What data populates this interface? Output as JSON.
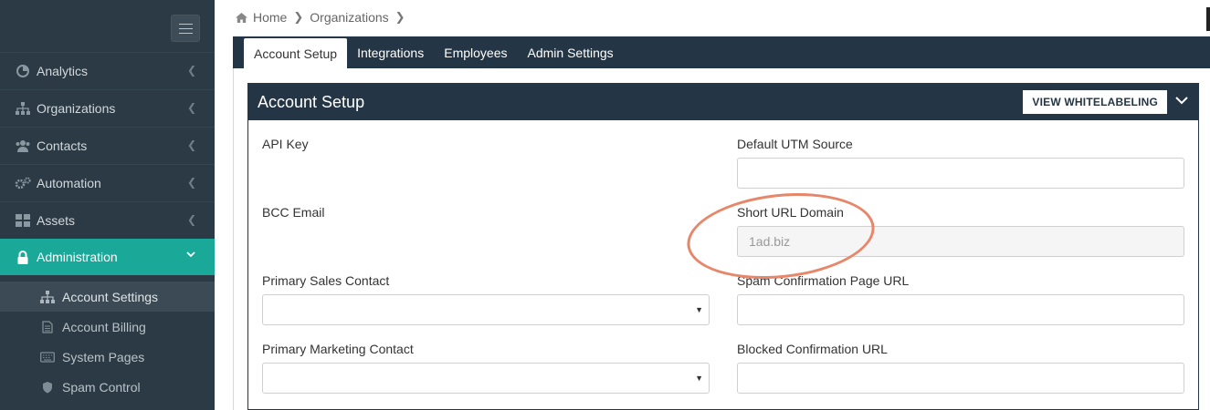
{
  "sidebar": {
    "items": [
      {
        "label": "Analytics",
        "icon": "bar-chart-icon"
      },
      {
        "label": "Organizations",
        "icon": "sitemap-icon"
      },
      {
        "label": "Contacts",
        "icon": "users-icon"
      },
      {
        "label": "Automation",
        "icon": "cogs-icon"
      },
      {
        "label": "Assets",
        "icon": "grid-icon"
      },
      {
        "label": "Administration",
        "icon": "lock-icon"
      }
    ],
    "subitems": [
      {
        "label": "Account Settings",
        "icon": "sitemap-icon"
      },
      {
        "label": "Account Billing",
        "icon": "document-icon"
      },
      {
        "label": "System Pages",
        "icon": "keyboard-icon"
      },
      {
        "label": "Spam Control",
        "icon": "shield-icon"
      }
    ]
  },
  "breadcrumb": {
    "home": "Home",
    "current": "Organizations"
  },
  "tabs": [
    {
      "label": "Account Setup"
    },
    {
      "label": "Integrations"
    },
    {
      "label": "Employees"
    },
    {
      "label": "Admin Settings"
    }
  ],
  "panel": {
    "title": "Account Setup",
    "button": "VIEW WHITELABELING"
  },
  "fields": {
    "api_key": "API Key",
    "bcc_email": "BCC Email",
    "primary_sales": "Primary Sales Contact",
    "primary_marketing": "Primary Marketing Contact",
    "default_utm": "Default UTM Source",
    "short_url": "Short URL Domain",
    "short_url_value": "1ad.biz",
    "spam_confirmation": "Spam Confirmation Page URL",
    "blocked_confirmation": "Blocked Confirmation URL"
  },
  "colors": {
    "sidebar": "#2b3a44",
    "active": "#1aa898",
    "header": "#243645",
    "highlight": "#e8866a"
  }
}
